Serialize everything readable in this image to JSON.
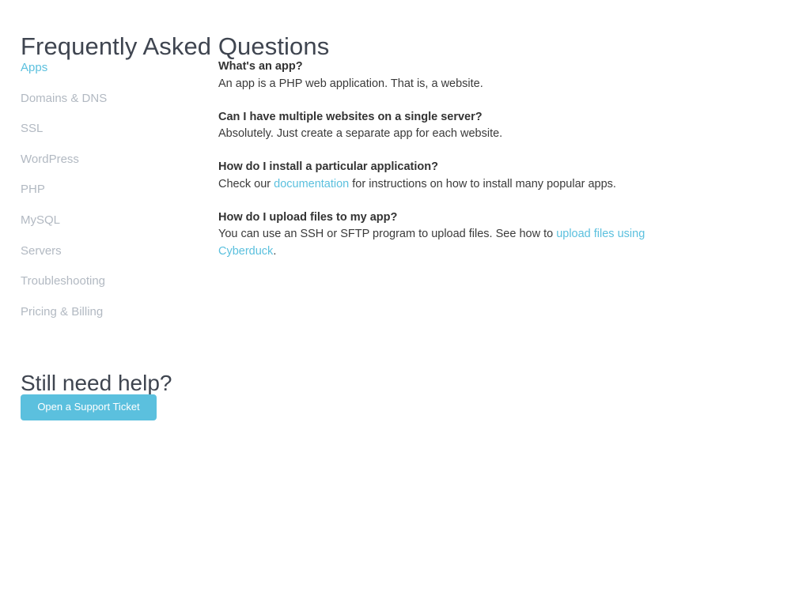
{
  "page": {
    "title": "Frequently Asked Questions",
    "background_color": "#ffffff",
    "text_color": "#333333",
    "accent_color": "#5bc0de",
    "muted_color": "#b2b9c2"
  },
  "sidebar": {
    "items": [
      {
        "label": "Apps",
        "active": true
      },
      {
        "label": "Domains & DNS",
        "active": false
      },
      {
        "label": "SSL",
        "active": false
      },
      {
        "label": "WordPress",
        "active": false
      },
      {
        "label": "PHP",
        "active": false
      },
      {
        "label": "MySQL",
        "active": false
      },
      {
        "label": "Servers",
        "active": false
      },
      {
        "label": "Troubleshooting",
        "active": false
      },
      {
        "label": "Pricing & Billing",
        "active": false
      }
    ]
  },
  "help": {
    "title": "Still need help?",
    "button_label": "Open a Support Ticket"
  },
  "faq": [
    {
      "question": "What's an app?",
      "answer_parts": [
        {
          "type": "text",
          "text": "An app is a PHP web application. That is, a website."
        }
      ]
    },
    {
      "question": "Can I have multiple websites on a single server?",
      "answer_parts": [
        {
          "type": "text",
          "text": "Absolutely. Just create a separate app for each website."
        }
      ]
    },
    {
      "question": "How do I install a particular application?",
      "answer_parts": [
        {
          "type": "text",
          "text": "Check our "
        },
        {
          "type": "link",
          "text": "documentation"
        },
        {
          "type": "text",
          "text": " for instructions on how to install many popular apps."
        }
      ]
    },
    {
      "question": "How do I upload files to my app?",
      "answer_parts": [
        {
          "type": "text",
          "text": "You can use an SSH or SFTP program to upload files. See how to "
        },
        {
          "type": "link",
          "text": "upload files using Cyberduck"
        },
        {
          "type": "text",
          "text": "."
        }
      ]
    }
  ]
}
